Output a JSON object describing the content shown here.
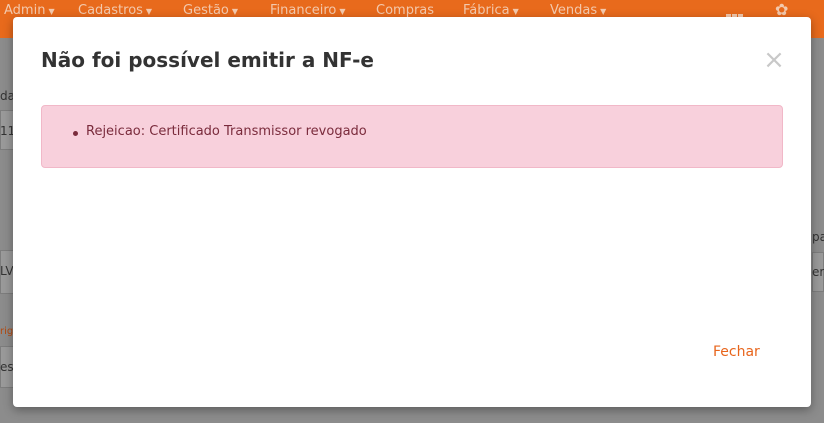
{
  "navbar": {
    "items": [
      {
        "label": "Admin"
      },
      {
        "label": "Cadastros"
      },
      {
        "label": "Gestão"
      },
      {
        "label": "Financeiro"
      },
      {
        "label": "Compras"
      },
      {
        "label": "Fábrica"
      },
      {
        "label": "Vendas"
      }
    ],
    "icons": [
      "grid-icon",
      "gear-icon"
    ],
    "accent_color": "#e86a1c"
  },
  "background_fragments": {
    "left": [
      "da",
      "11",
      "LV",
      "rig",
      "es"
    ],
    "right": [
      "pa",
      "er"
    ]
  },
  "modal": {
    "title": "Não foi possível emitir a NF-e",
    "close_symbol": "×",
    "errors": [
      "Rejeicao: Certificado Transmissor revogado"
    ],
    "close_button_label": "Fechar",
    "alert_background": "#f8d0dc",
    "button_color": "#e8651c"
  }
}
